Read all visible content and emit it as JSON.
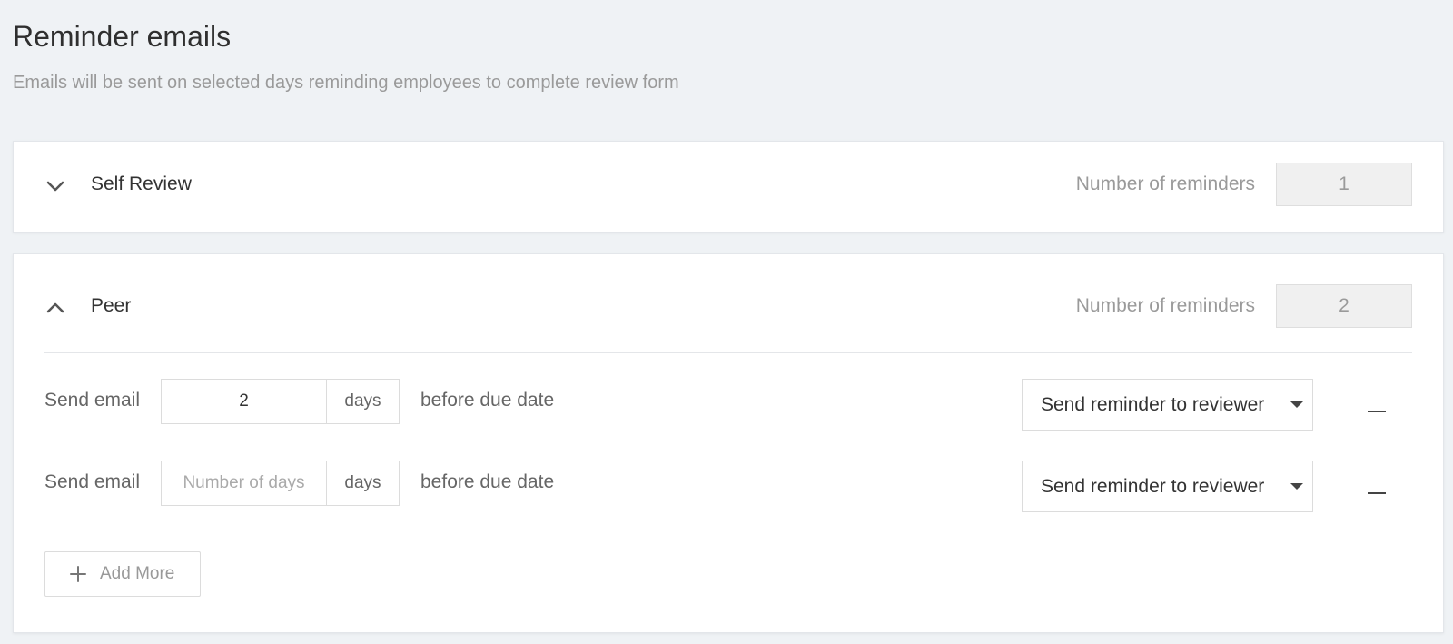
{
  "header": {
    "title": "Reminder emails",
    "subtitle": "Emails will be sent on selected days reminding employees to complete review form"
  },
  "sections": {
    "self_review": {
      "name": "Self Review",
      "expanded": false,
      "reminders_label": "Number of reminders",
      "reminders_count": "1",
      "icon": "chevron-down-icon"
    },
    "peer": {
      "name": "Peer",
      "expanded": true,
      "reminders_label": "Number of reminders",
      "reminders_count": "2",
      "icon": "chevron-up-icon",
      "rows": [
        {
          "send_label": "Send email",
          "days_value": "2",
          "days_placeholder": "Number of days",
          "days_suffix": "days",
          "before_label": "before due date",
          "recipient": "Send reminder to reviewer"
        },
        {
          "send_label": "Send email",
          "days_value": "",
          "days_placeholder": "Number of days",
          "days_suffix": "days",
          "before_label": "before due date",
          "recipient": "Send reminder to reviewer"
        }
      ],
      "add_more_label": "Add More"
    }
  },
  "colors": {
    "background": "#eff2f5",
    "card": "#ffffff",
    "muted_text": "#9a9a9a"
  }
}
